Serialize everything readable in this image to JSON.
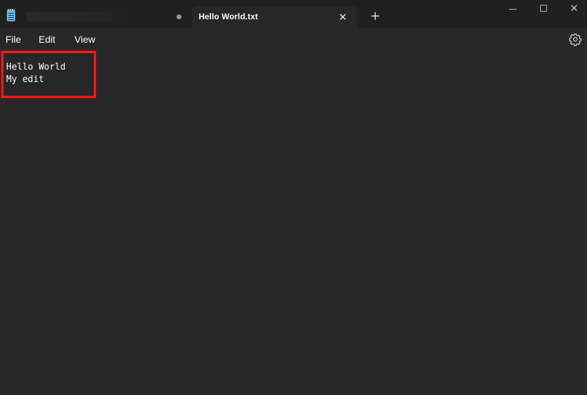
{
  "titlebar": {
    "inactive_tab_title": "",
    "active_tab_title": "Hello World.txt",
    "new_tab_label": "+",
    "close_tab_glyph": "✕"
  },
  "window_controls": {
    "close_glyph": "✕"
  },
  "menu": {
    "file": "File",
    "edit": "Edit",
    "view": "View"
  },
  "editor": {
    "content": "Hello World\nMy edit"
  },
  "icons": {
    "app": "notepad-icon",
    "settings": "gear-icon",
    "unsaved": "unsaved-dot-icon"
  },
  "colors": {
    "titlebar_bg": "#202020",
    "editor_bg": "#272727",
    "text": "#ffffff",
    "highlight": "#ff1a1a"
  }
}
